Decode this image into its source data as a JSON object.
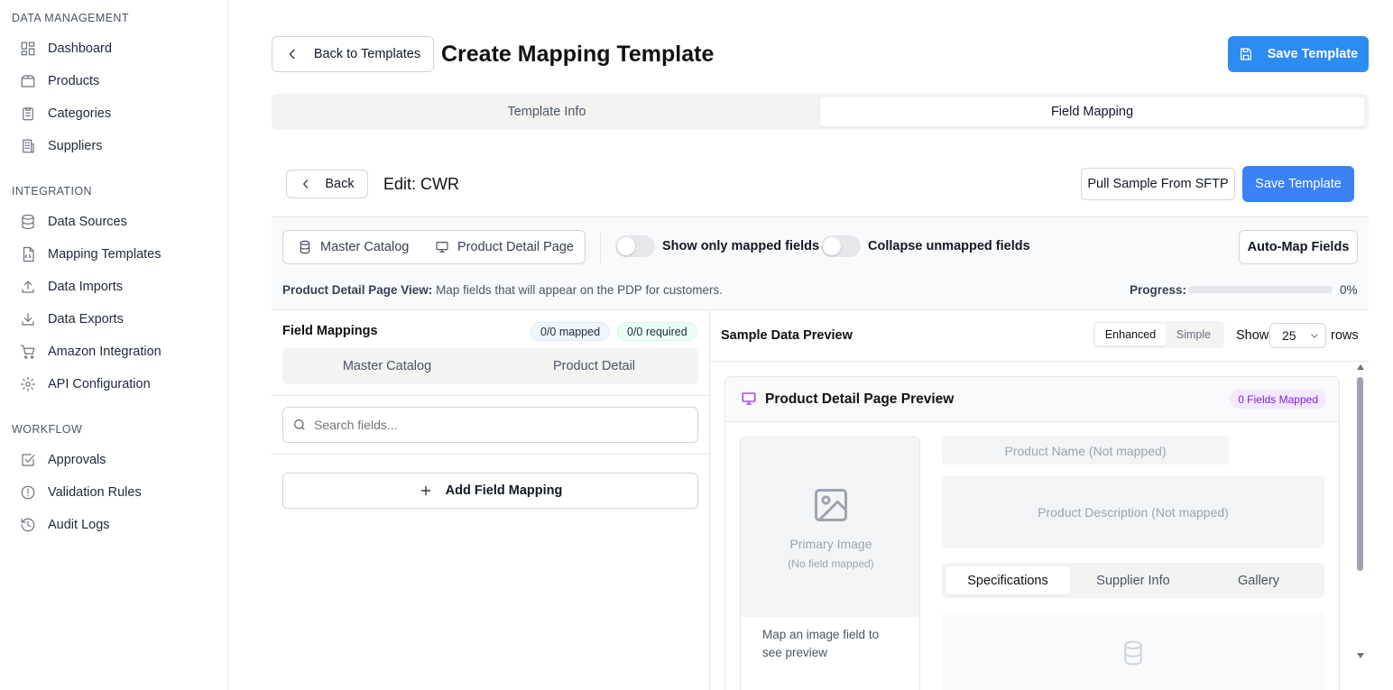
{
  "sidebar": {
    "sections": [
      {
        "title": "DATA MANAGEMENT",
        "items": [
          "Dashboard",
          "Products",
          "Categories",
          "Suppliers"
        ]
      },
      {
        "title": "INTEGRATION",
        "items": [
          "Data Sources",
          "Mapping Templates",
          "Data Imports",
          "Data Exports",
          "Amazon Integration",
          "API Configuration"
        ]
      },
      {
        "title": "WORKFLOW",
        "items": [
          "Approvals",
          "Validation Rules",
          "Audit Logs"
        ]
      }
    ]
  },
  "header": {
    "back_label": "Back to Templates",
    "title": "Create Mapping Template",
    "save_label": "Save Template"
  },
  "tabs": [
    "Template Info",
    "Field Mapping"
  ],
  "editor": {
    "back_label": "Back",
    "title": "Edit: CWR",
    "pull_label": "Pull Sample From SFTP",
    "save_label": "Save Template",
    "view_modes": [
      "Master Catalog",
      "Product Detail Page"
    ],
    "toggle_mapped": "Show only mapped fields",
    "toggle_collapse": "Collapse unmapped fields",
    "auto_map": "Auto-Map Fields",
    "desc_bold": "Product Detail Page View:",
    "desc_text": " Map fields that will appear on the PDP for customers.",
    "progress_label": "Progress:",
    "progress_value": "0%",
    "progress_fraction": 0
  },
  "mappings": {
    "title": "Field Mappings",
    "mapped_badge": "0/0 mapped",
    "required_badge": "0/0 required",
    "tabs": [
      "Master Catalog",
      "Product Detail"
    ],
    "search_placeholder": "Search fields...",
    "add_label": "Add Field Mapping"
  },
  "preview": {
    "title": "Sample Data Preview",
    "modes": [
      "Enhanced",
      "Simple"
    ],
    "show_label": "Show",
    "rows_value": "25",
    "rows_label": "rows",
    "card_title": "Product Detail Page Preview",
    "fields_badge": "0 Fields Mapped",
    "primary_image": "Primary Image",
    "no_field": "(No field mapped)",
    "map_hint": "Map an image field to see preview",
    "product_name": "Product Name (Not mapped)",
    "product_desc": "Product Description (Not mapped)",
    "detail_tabs": [
      "Specifications",
      "Supplier Info",
      "Gallery"
    ]
  },
  "colors": {
    "primary": "#2d8cf0",
    "purple": "#9333ea"
  }
}
